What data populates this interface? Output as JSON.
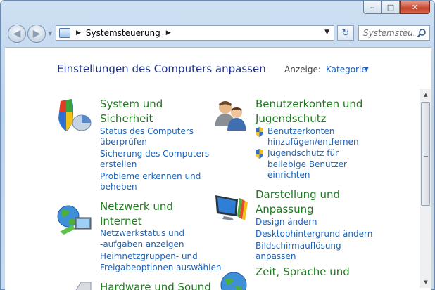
{
  "window": {
    "minimize_glyph": "‒",
    "maximize_glyph": "□",
    "close_glyph": "✕"
  },
  "nav": {
    "back_glyph": "◀",
    "forward_glyph": "▶",
    "path_separator": "▶",
    "breadcrumb": "Systemsteuerung",
    "breadcrumb_separator": "▶",
    "dropdown_glyph": "▼",
    "refresh_glyph": "↻",
    "search_placeholder": "Systemsteu..."
  },
  "header": {
    "title": "Einstellungen des Computers anpassen",
    "view_label": "Anzeige:",
    "view_value": "Kategorie",
    "view_arrow": "▼"
  },
  "categories": [
    {
      "icon": "system-security-icon",
      "title_line1": "System und",
      "title_line2": "Sicherheit",
      "links": [
        "Status des Computers",
        "überprüfen",
        "Sicherung des Computers",
        "erstellen",
        "Probleme erkennen und",
        "beheben"
      ]
    },
    {
      "icon": "network-icon",
      "title_line1": "Netzwerk und",
      "title_line2": "Internet",
      "links": [
        "Netzwerkstatus und",
        "-aufgaben anzeigen",
        "Heimnetzgruppen- und",
        "Freigabeoptionen auswählen"
      ]
    },
    {
      "icon": "hardware-sound-icon",
      "title_line1": "Hardware und Sound"
    },
    {
      "icon": "user-accounts-icon",
      "title_line1": "Benutzerkonten und",
      "title_line2": "Jugendschutz",
      "links": [
        "Benutzerkonten",
        "hinzufügen/entfernen",
        "Jugendschutz für",
        "beliebige Benutzer",
        "einrichten"
      ]
    },
    {
      "icon": "appearance-icon",
      "title_line1": "Darstellung und",
      "title_line2": "Anpassung",
      "links": [
        "Design ändern",
        "Desktophintergrund ändern",
        "Bildschirmauflösung",
        "anpassen"
      ]
    },
    {
      "icon": "clock-language-icon",
      "title_line1": "Zeit, Sprache und"
    }
  ],
  "scrollbar": {
    "up_glyph": "▲",
    "down_glyph": "▼"
  }
}
